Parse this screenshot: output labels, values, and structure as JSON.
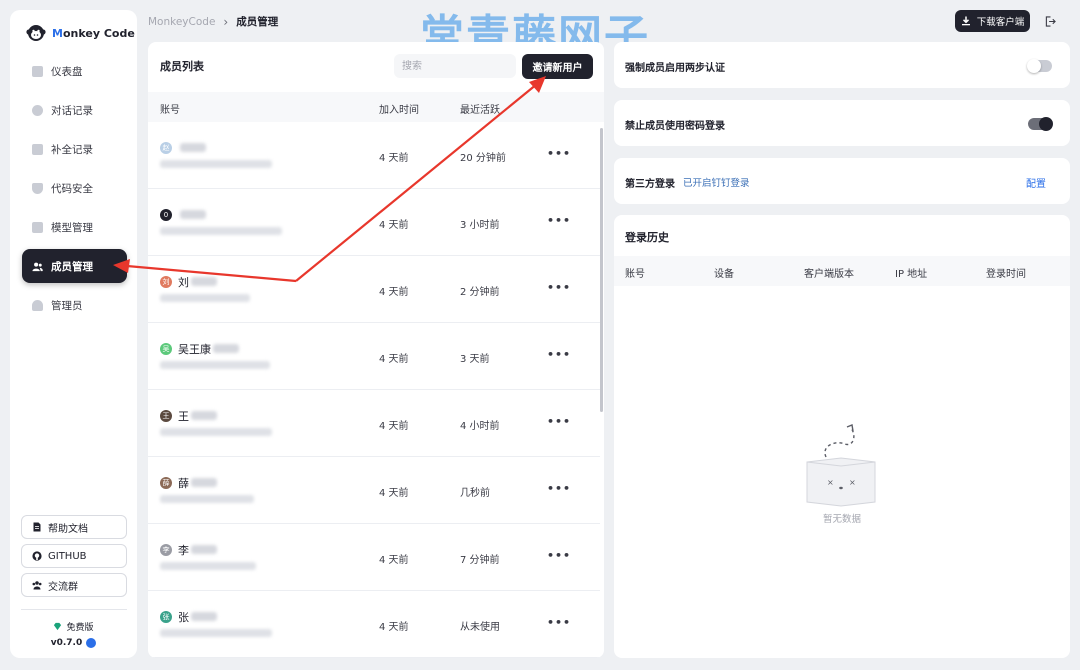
{
  "brand": {
    "prefix": "M",
    "rest": "onkey Code"
  },
  "breadcrumb": {
    "root": "MonkeyCode",
    "separator": "›",
    "current": "成员管理"
  },
  "header": {
    "download_label": "下载客户端"
  },
  "watermark": "常青藤网子",
  "sidebar": {
    "items": [
      {
        "label": "仪表盘",
        "icon": "dashboard-icon",
        "active": false
      },
      {
        "label": "对话记录",
        "icon": "chat-icon",
        "active": false
      },
      {
        "label": "补全记录",
        "icon": "clipboard-icon",
        "active": false
      },
      {
        "label": "代码安全",
        "icon": "shield-icon",
        "active": false
      },
      {
        "label": "模型管理",
        "icon": "cube-icon",
        "active": false
      },
      {
        "label": "成员管理",
        "icon": "users-icon",
        "active": true
      },
      {
        "label": "管理员",
        "icon": "user-icon",
        "active": false
      }
    ],
    "links": [
      {
        "label": "帮助文档",
        "icon": "doc-icon"
      },
      {
        "label": "GITHUB",
        "icon": "github-icon"
      },
      {
        "label": "交流群",
        "icon": "group-icon"
      }
    ],
    "plan": "免费版",
    "version": "v0.7.0"
  },
  "members": {
    "title": "成员列表",
    "search_placeholder": "搜索",
    "invite_label": "邀请新用户",
    "columns": [
      "账号",
      "加入时间",
      "最近活跃"
    ],
    "rows": [
      {
        "avatar": "赵",
        "avatar_color": "#b9cfe6",
        "name": "",
        "joined": "4 天前",
        "active": "20 分钟前",
        "sub_width": 112
      },
      {
        "avatar": "0",
        "avatar_color": "#21222d",
        "name": "",
        "joined": "4 天前",
        "active": "3 小时前",
        "sub_width": 122
      },
      {
        "avatar": "刘",
        "avatar_color": "#e07a5f",
        "name": "刘",
        "joined": "4 天前",
        "active": "2 分钟前",
        "sub_width": 90
      },
      {
        "avatar": "吴",
        "avatar_color": "#5cc97b",
        "name": "吴王康",
        "joined": "4 天前",
        "active": "3 天前",
        "sub_width": 110
      },
      {
        "avatar": "王",
        "avatar_color": "#5b4a3f",
        "name": "王",
        "joined": "4 天前",
        "active": "4 小时前",
        "sub_width": 112
      },
      {
        "avatar": "薛",
        "avatar_color": "#8c6a57",
        "name": "薛",
        "joined": "4 天前",
        "active": "几秒前",
        "sub_width": 94
      },
      {
        "avatar": "李",
        "avatar_color": "#9a9ca4",
        "name": "李",
        "joined": "4 天前",
        "active": "7 分钟前",
        "sub_width": 96
      },
      {
        "avatar": "张",
        "avatar_color": "#3aa28b",
        "name": "张",
        "joined": "4 天前",
        "active": "从未使用",
        "sub_width": 112
      }
    ]
  },
  "settings": {
    "two_factor": {
      "label": "强制成员启用两步认证",
      "enabled": false
    },
    "disable_password": {
      "label": "禁止成员使用密码登录",
      "enabled": true
    },
    "third_party": {
      "label": "第三方登录",
      "status": "已开启钉钉登录",
      "config_label": "配置"
    }
  },
  "login_history": {
    "title": "登录历史",
    "columns": [
      "账号",
      "设备",
      "客户端版本",
      "IP 地址",
      "登录时间"
    ],
    "empty_text": "暂无数据"
  },
  "colors": {
    "accent": "#21222d",
    "link": "#2b6fe8",
    "annotation": "#e8372c"
  }
}
